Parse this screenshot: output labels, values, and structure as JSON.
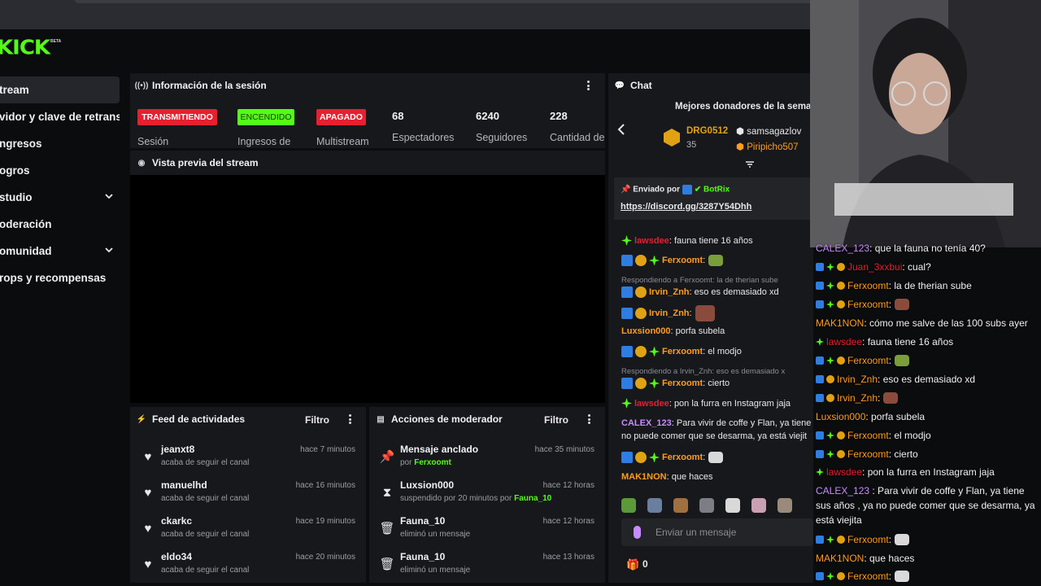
{
  "brand": {
    "logo": "KICK",
    "beta": "BETA",
    "color": "#53fc18"
  },
  "sidebar": {
    "items": [
      {
        "label": "tream"
      },
      {
        "label": "vidor y clave de retransm"
      },
      {
        "label": "ngresos"
      },
      {
        "label": "ogros"
      },
      {
        "label": "studio"
      },
      {
        "label": "oderación"
      },
      {
        "label": "omunidad"
      },
      {
        "label": "rops y recompensas"
      }
    ]
  },
  "session": {
    "title": "Información de la sesión",
    "badges": [
      {
        "label": "TRANSMITIENDO",
        "caption": "Sesión"
      },
      {
        "label": "ENCENDIDO",
        "caption": "Ingresos de"
      },
      {
        "label": "APAGADO",
        "caption": "Multistream"
      }
    ],
    "stats": [
      {
        "value": "68",
        "label": "Espectadores"
      },
      {
        "value": "6240",
        "label": "Seguidores"
      },
      {
        "value": "228",
        "label": "Cantidad de"
      }
    ]
  },
  "preview": {
    "title": "Vista previa del stream"
  },
  "feed": {
    "title": "Feed de actividades",
    "filter": "Filtro",
    "rows": [
      {
        "name": "jeanxt8",
        "sub": "acaba de seguir el canal",
        "time": "hace 7 minutos"
      },
      {
        "name": "manuelhd",
        "sub": "acaba de seguir el canal",
        "time": "hace 16 minutos"
      },
      {
        "name": "ckarkc",
        "sub": "acaba de seguir el canal",
        "time": "hace 19 minutos"
      },
      {
        "name": "eldo34",
        "sub": "acaba de seguir el canal",
        "time": "hace 20 minutos"
      }
    ]
  },
  "mod": {
    "title": "Acciones de moderador",
    "filter": "Filtro",
    "rows": [
      {
        "name": "Mensaje anclado",
        "sub_pre": "por ",
        "sub_user": "Ferxoomt",
        "time": "hace 35 minutos",
        "icon": "pin-icon"
      },
      {
        "name": "Luxsion000",
        "sub_pre": "suspendido por 20 minutos por ",
        "sub_user": "Fauna_10",
        "time": "hace 12 horas",
        "icon": "hourglass-icon"
      },
      {
        "name": "Fauna_10",
        "sub_pre": "eliminó un mensaje",
        "sub_user": "",
        "time": "hace 12 horas",
        "icon": "trash-icon"
      },
      {
        "name": "Fauna_10",
        "sub_pre": "eliminó un mensaje",
        "sub_user": "",
        "time": "hace 13 horas",
        "icon": "trash-icon"
      }
    ]
  },
  "chat": {
    "title": "Chat",
    "top_donors_title": "Mejores donadores de la sema",
    "donors": [
      {
        "name": "DRG0512",
        "amount": "35"
      },
      {
        "name": "samsagazlov"
      },
      {
        "name": "Piripicho507"
      }
    ],
    "pinned": {
      "label": "Enviado por",
      "user": "BotRix",
      "link": "https://discord.gg/3287Y54Dhh"
    },
    "messages": [
      {
        "user": "lawsdee",
        "text": "fauna tiene 16 años"
      },
      {
        "user": "Ferxoomt",
        "text": ""
      },
      {
        "reply": "Respondiendo a Ferxoomt: la de therian sube",
        "user": "Irvin_Znh",
        "text": "eso es demasiado xd"
      },
      {
        "user": "Irvin_Znh",
        "text": ""
      },
      {
        "user": "Luxsion000",
        "text": "porfa subela"
      },
      {
        "user": "Ferxoomt",
        "text": "el modjo"
      },
      {
        "reply": "Respondiendo a Irvin_Znh: eso es demasiado x",
        "user": "Ferxoomt",
        "text": "cierto"
      },
      {
        "user": "lawsdee",
        "text": "pon la furra en Instagram jaja"
      },
      {
        "user": "CALEX_123",
        "text": "Para vivir de coffe y Flan, ya tiene",
        "text2": "no puede comer que se desarma, ya está viejit"
      },
      {
        "user": "Ferxoomt",
        "text": ""
      },
      {
        "user": "MAK1NON",
        "text": "que haces"
      }
    ],
    "input_placeholder": "Enviar un mensaje",
    "points": "0"
  },
  "overlay": {
    "lines": [
      {
        "user": "CALEX_123",
        "text": ": que la fauna no tenía 40?"
      },
      {
        "user": "Juan_3xxbui",
        "text": ": cual?"
      },
      {
        "user": "Ferxoomt",
        "text": ": la de therian sube"
      },
      {
        "user": "Ferxoomt",
        "text": ":"
      },
      {
        "user": "MAK1NON",
        "text": ": cómo me salve de las 100 subs ayer"
      },
      {
        "user": "lawsdee",
        "text": ": fauna tiene 16 años"
      },
      {
        "user": "Ferxoomt",
        "text": ":"
      },
      {
        "user": "Irvin_Znh",
        "text": ": eso es demasiado xd"
      },
      {
        "user": "Irvin_Znh",
        "text": ":"
      },
      {
        "user": "Luxsion000",
        "text": ": porfa subela"
      },
      {
        "user": "Ferxoomt",
        "text": ": el modjo"
      },
      {
        "user": "Ferxoomt",
        "text": ": cierto"
      },
      {
        "user": "lawsdee",
        "text": ": pon la furra en Instagram jaja"
      },
      {
        "user": "CALEX_123",
        "text": ": Para vivir de coffe y Flan, ya tiene sus años , ya no puede comer que se desarma, ya está viejita"
      },
      {
        "user": "Ferxoomt",
        "text": ":"
      },
      {
        "user": "MAK1NON",
        "text": ": que haces"
      },
      {
        "user": "Ferxoomt",
        "text": ":"
      }
    ]
  }
}
